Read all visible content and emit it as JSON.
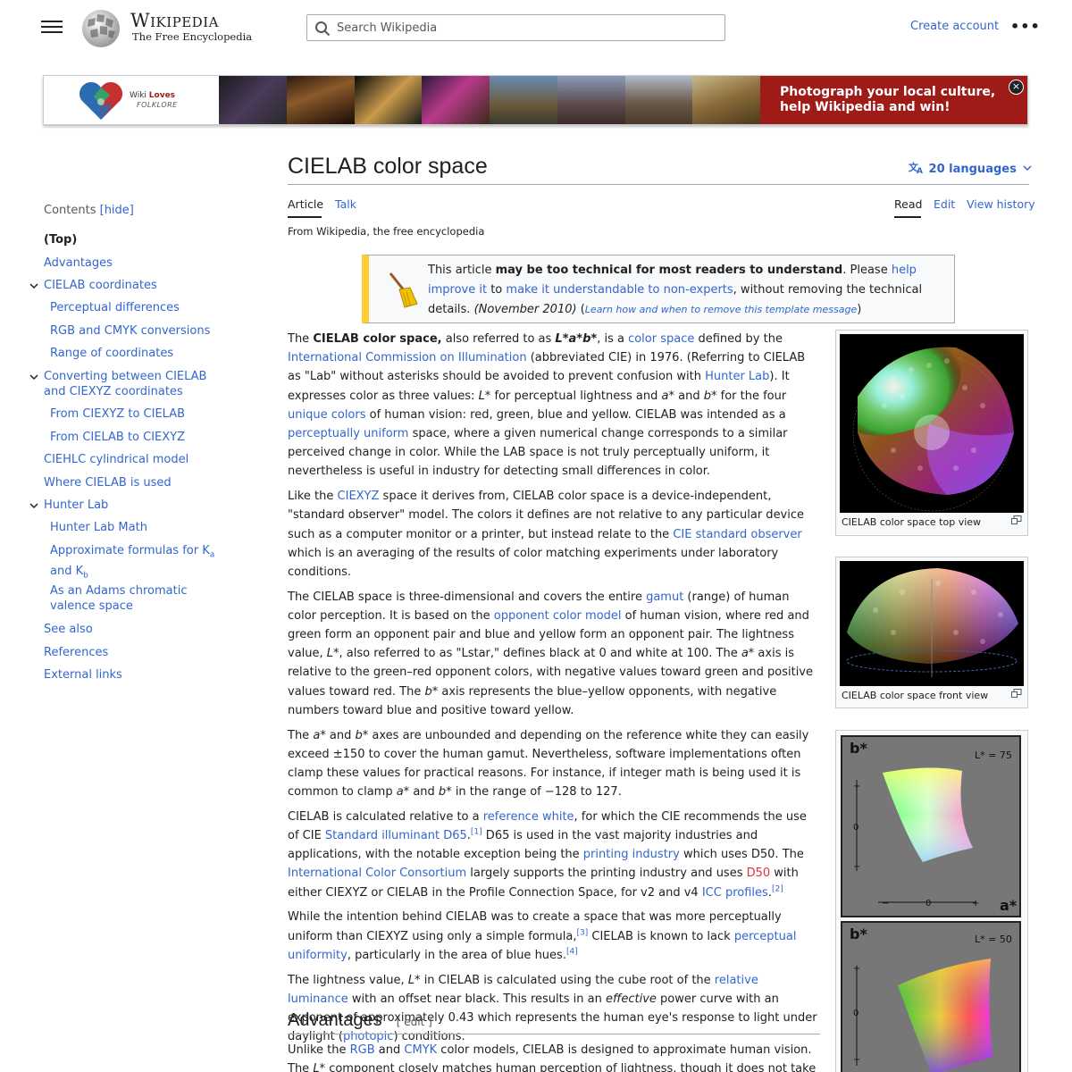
{
  "header": {
    "wordmark": "Wikipedia",
    "tagline": "The Free Encyclopedia",
    "search_placeholder": "Search Wikipedia",
    "create_account": "Create account",
    "more": "•••"
  },
  "banner": {
    "logo_wiki": "Wiki",
    "logo_loves": "Loves",
    "logo_folklore": "FOLKLORE",
    "cta_line1": "Photograph your local culture,",
    "cta_line2": "help Wikipedia and win!",
    "close": "×"
  },
  "toc": {
    "heading": "Contents",
    "hide": "[hide]",
    "items": [
      {
        "label": "(Top)"
      },
      {
        "label": "Advantages"
      },
      {
        "label": "CIELAB coordinates"
      },
      {
        "label": "Perceptual differences"
      },
      {
        "label": "RGB and CMYK conversions"
      },
      {
        "label": "Range of coordinates"
      },
      {
        "label": "Converting between CIELAB"
      },
      {
        "label": "and CIEXYZ coordinates"
      },
      {
        "label": "From CIEXYZ to CIELAB"
      },
      {
        "label": "From CIELAB to CIEXYZ"
      },
      {
        "label": "CIEHLC cylindrical model"
      },
      {
        "label": "Where CIELAB is used"
      },
      {
        "label": "Hunter Lab"
      },
      {
        "label": "Hunter Lab Math"
      },
      {
        "label": "Approximate formulas for K"
      },
      {
        "label": "a"
      },
      {
        "label": "and K"
      },
      {
        "label": "b"
      },
      {
        "label": "As an Adams chromatic"
      },
      {
        "label": "valence space"
      },
      {
        "label": "See also"
      },
      {
        "label": "References"
      },
      {
        "label": "External links"
      }
    ]
  },
  "article": {
    "title": "CIELAB color space",
    "languages": "20 languages",
    "tabs": {
      "article": "Article",
      "talk": "Talk",
      "read": "Read",
      "edit": "Edit",
      "history": "View history"
    },
    "from": "From Wikipedia, the free encyclopedia",
    "ambox": {
      "t1": "This article ",
      "t2": "may be too technical for most readers to understand",
      "t3": ". Please ",
      "t4": "help improve it",
      "t5": " to ",
      "t6": "make it understandable to non-experts",
      "t7": ", without removing the technical details. ",
      "t8": "(November 2010)",
      "t9": " (",
      "t10": "Learn how and when to remove this template message",
      "t11": ")"
    },
    "p1": {
      "a": "The ",
      "b": "CIELAB color space,",
      "c": " also referred to as ",
      "d": "L*a*b*",
      "e": ", is a ",
      "f": "color space",
      "g": " defined by the ",
      "h": "International Commission on Illumination",
      "i": " (abbreviated CIE) in 1976. (Referring to CIELAB as \"Lab\" without asterisks should be avoided to prevent confusion with ",
      "j": "Hunter Lab",
      "k": "). It expresses color as three values: ",
      "l": "L*",
      "m": " for perceptual lightness and ",
      "n": "a*",
      "o": " and ",
      "p": "b*",
      "q": " for the four ",
      "r": "unique colors",
      "s": " of human vision: red, green, blue and yellow. CIELAB was intended as a ",
      "t": "perceptually uniform",
      "u": " space, where a given numerical change corresponds to a similar perceived change in color. While the LAB space is not truly perceptually uniform, it nevertheless is useful in industry for detecting small differences in color."
    },
    "p2": {
      "a": "Like the ",
      "b": "CIEXYZ",
      "c": " space it derives from, CIELAB color space is a device-independent, \"standard observer\" model. The colors it defines are not relative to any particular device such as a computer monitor or a printer, but instead relate to the ",
      "d": "CIE standard observer",
      "e": " which is an averaging of the results of color matching experiments under laboratory conditions."
    },
    "p3": {
      "a": "The CIELAB space is three-dimensional and covers the entire ",
      "b": "gamut",
      "c": " (range) of human color perception. It is based on the ",
      "d": "opponent color model",
      "e": " of human vision, where red and green form an opponent pair and blue and yellow form an opponent pair. The lightness value, ",
      "f": "L*",
      "g": ", also referred to as \"Lstar,\" defines black at 0 and white at 100. The ",
      "h": "a*",
      "i": " axis is relative to the green–red opponent colors, with negative values toward green and positive values toward red. The ",
      "j": "b*",
      "k": " axis represents the blue–yellow opponents, with negative numbers toward blue and positive toward yellow."
    },
    "p4": {
      "a": "The ",
      "b": "a*",
      "c": " and ",
      "d": "b*",
      "e": " axes are unbounded and depending on the reference white they can easily exceed ±150 to cover the human gamut. Nevertheless, software implementations often clamp these values for practical reasons. For instance, if integer math is being used it is common to clamp ",
      "f": "a*",
      "g": " and ",
      "h": "b*",
      "i": " in the range of −128 to 127."
    },
    "p5": {
      "a": "CIELAB is calculated relative to a ",
      "b": "reference white",
      "c": ", for which the CIE recommends the use of CIE ",
      "d": "Standard illuminant D65",
      "e": ".",
      "f": "[1]",
      "g": " D65 is used in the vast majority industries and applications, with the notable exception being the ",
      "h": "printing industry",
      "i": " which uses D50. The ",
      "j": "International Color Consortium",
      "k": " largely supports the printing industry and uses ",
      "l": "D50",
      "m": " with either CIEXYZ or CIELAB in the Profile Connection Space, for v2 and v4 ",
      "n": "ICC profiles",
      "o": ".",
      "p": "[2]"
    },
    "p6": {
      "a": "While the intention behind CIELAB was to create a space that was more perceptually uniform than CIEXYZ using only a simple formula,",
      "b": "[3]",
      "c": " CIELAB is known to lack ",
      "d": "perceptual uniformity",
      "e": ", particularly in the area of blue hues.",
      "f": "[4]"
    },
    "p7": {
      "a": "The lightness value, ",
      "b": "L*",
      "c": " in CIELAB is calculated using the cube root of the ",
      "d": "relative luminance",
      "e": " with an offset near black. This results in an ",
      "f": "effective",
      "g": " power curve with an exponent of approximately 0.43 which represents the human eye's response to light under daylight (",
      "h": "photopic",
      "i": ") conditions."
    },
    "advantages": {
      "title": "Advantages",
      "edit": "[ edit ]",
      "a": "Unlike the ",
      "b": "RGB",
      "c": " and ",
      "d": "CMYK",
      "e": " color models, CIELAB is designed to approximate human vision. The ",
      "f": "L*",
      "g": " component closely matches human perception of lightness, though it does not take the"
    }
  },
  "figures": {
    "top_caption": "CIELAB color space top view",
    "front_caption": "CIELAB color space front view",
    "panel1": {
      "b_label": "b*",
      "a_label": "a*",
      "l_label": "L* = 75",
      "plus": "+",
      "zero": "0",
      "minus": "−"
    },
    "panel2": {
      "b_label": "b*",
      "l_label": "L* = 50",
      "plus": "+",
      "zero": "0",
      "minus": "−"
    }
  }
}
